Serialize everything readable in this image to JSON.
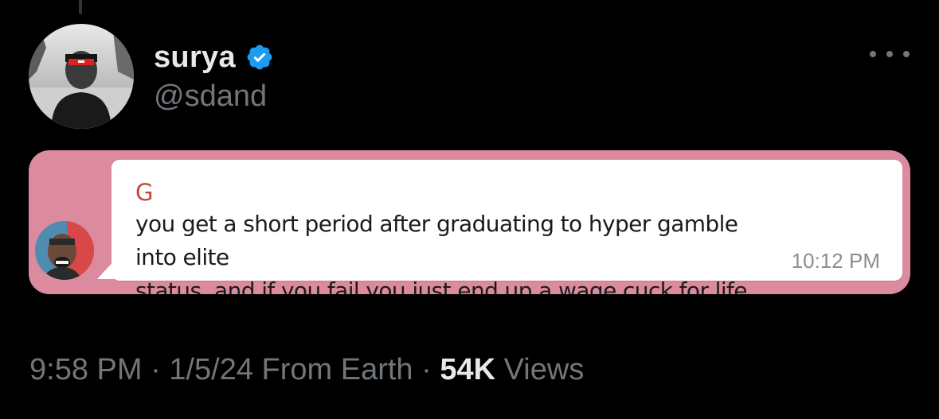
{
  "author": {
    "name": "surya",
    "handle": "@sdand",
    "verified": true,
    "verified_color": "#1d9bf0"
  },
  "menu": {
    "icon": "more-horizontal-icon"
  },
  "media": {
    "background_color": "#dc8a9d",
    "message": {
      "sender": "G",
      "sender_color": "#c2493d",
      "line1": "you get a short period after graduating to hyper gamble into elite",
      "line2": "status, and if you fail you just end up a wage cuck for life",
      "time": "10:12 PM"
    }
  },
  "meta": {
    "time": "9:58 PM",
    "sep1": " · ",
    "date": "1/5/24",
    "source": "From Earth",
    "sep2": " · ",
    "views_count": "54K",
    "views_label": "Views"
  }
}
